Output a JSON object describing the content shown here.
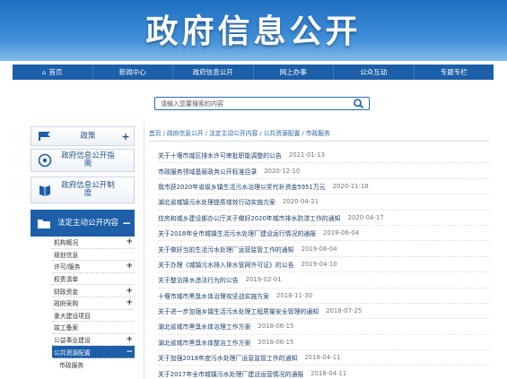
{
  "header": {
    "title": "政府信息公开"
  },
  "nav": [
    {
      "label": "首页",
      "icon": "home-icon"
    },
    {
      "label": "新闻中心"
    },
    {
      "label": "政府信息公开"
    },
    {
      "label": "网上办事"
    },
    {
      "label": "公众互动"
    },
    {
      "label": "专题专栏"
    }
  ],
  "search": {
    "placeholder": "请输入您要搜索的内容",
    "icon": "search-icon"
  },
  "sidebar": {
    "buttons": [
      {
        "label": "政策",
        "icon": "flag-icon",
        "plus": "+"
      },
      {
        "label": "政府信息公开指南",
        "icon": "compass-icon",
        "plus": ""
      },
      {
        "label": "政府信息公开制度",
        "icon": "book-icon",
        "plus": ""
      }
    ],
    "active_section": {
      "label": "法定主动公开内容",
      "icon": "folder-icon",
      "toggle": "−"
    },
    "items": [
      {
        "label": "机构概况",
        "plus": "+"
      },
      {
        "label": "规划信息",
        "plus": ""
      },
      {
        "label": "许可/服务",
        "plus": "+"
      },
      {
        "label": "权责清单",
        "plus": ""
      },
      {
        "label": "财政资金",
        "plus": "+"
      },
      {
        "label": "政府采购",
        "plus": "+"
      },
      {
        "label": "重大建设项目",
        "plus": ""
      },
      {
        "label": "竣工备案",
        "plus": ""
      },
      {
        "label": "公益事业建设",
        "plus": "+"
      },
      {
        "label": "公共资源配置",
        "plus": "−",
        "active": true
      },
      {
        "label": "市政服务",
        "plus": "",
        "sub": true
      }
    ]
  },
  "breadcrumb": [
    "首页",
    "政府信息公开",
    "法定主动公开内容",
    "公共资源配置",
    "市政服务"
  ],
  "news": [
    {
      "title": "关于十堰市城区排水许可审批职能调整的公告",
      "date": "2021-01-13"
    },
    {
      "title": "市政服务领域基层政务公开标准目录",
      "date": "2020-12-10"
    },
    {
      "title": "我市获2020年省级乡镇生活污水治理以奖代补资金5951万元",
      "date": "2020-11-18"
    },
    {
      "title": "湖北省城镇污水处理提质增效行动实施方案",
      "date": "2020-04-21"
    },
    {
      "title": "住房和城乡建设部办公厅关于做好2020年城市排水防涝工作的通知",
      "date": "2020-04-17"
    },
    {
      "title": "关于2018年全市城镇生活污水处理厂建设运行情况的通报",
      "date": "2019-06-04"
    },
    {
      "title": "关于做好当前生活污水处理厂运营监管工作的通知",
      "date": "2019-06-04"
    },
    {
      "title": "关于办理《城镇污水排入排水管网许可证》的公告",
      "date": "2019-04-10"
    },
    {
      "title": "关于整治排水违法行为的公告",
      "date": "2019-02-01"
    },
    {
      "title": "十堰市城市黑臭水体治理攻坚战实施方案",
      "date": "2018-11-30"
    },
    {
      "title": "关于进一步加强乡镇生活污水处理工程质量安全管理的通知",
      "date": "2018-07-25"
    },
    {
      "title": "湖北省城市黑臭水体治理工作方案",
      "date": "2018-06-15"
    },
    {
      "title": "湖北省城市黑臭水体整治工作方案",
      "date": "2018-06-15"
    },
    {
      "title": "关于加强2018年度污水处理厂运营监管工作的通知",
      "date": "2018-04-11"
    },
    {
      "title": "关于2017年全市城镇污水处理厂建设运营情况的通报",
      "date": "2018-04-11"
    }
  ]
}
